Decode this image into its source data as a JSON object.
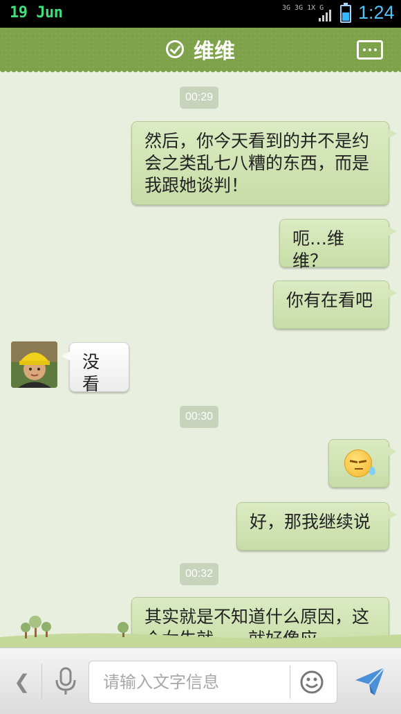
{
  "status_bar": {
    "date": "19 Jun",
    "network": "3G 3G 1X G",
    "battery_level": 0.6,
    "time": "1:24"
  },
  "header": {
    "title": "维维",
    "verified_icon": "check-circle-icon",
    "more_icon": "more-dots-icon"
  },
  "timestamps": [
    "00:29",
    "00:30",
    "00:32"
  ],
  "messages": [
    {
      "side": "right",
      "text": "然后，你今天看到的并不是约会之类乱七八糟的东西，而是我跟她谈判！"
    },
    {
      "side": "right",
      "text": "呃…维维？"
    },
    {
      "side": "right",
      "text": "你有在看吧"
    },
    {
      "side": "left",
      "text": "没看"
    },
    {
      "side": "right",
      "emoji": "sweat-annoyed-face"
    },
    {
      "side": "right",
      "text": "好，那我继续说"
    },
    {
      "side": "right",
      "text": "其实就是不知道什么原因，这个女生就……就好像应"
    }
  ],
  "input_bar": {
    "placeholder": "请输入文字信息",
    "back_icon": "chevron-left-icon",
    "mic_icon": "microphone-icon",
    "emoji_icon": "smiley-icon",
    "send_icon": "send-arrow-icon"
  },
  "colors": {
    "header_bg": "#7da24a",
    "chat_bg": "#e8efde",
    "outgoing_bubble": "#cfe1b1",
    "incoming_bubble": "#f4f4f4",
    "time_text": "#4fc3f7"
  }
}
